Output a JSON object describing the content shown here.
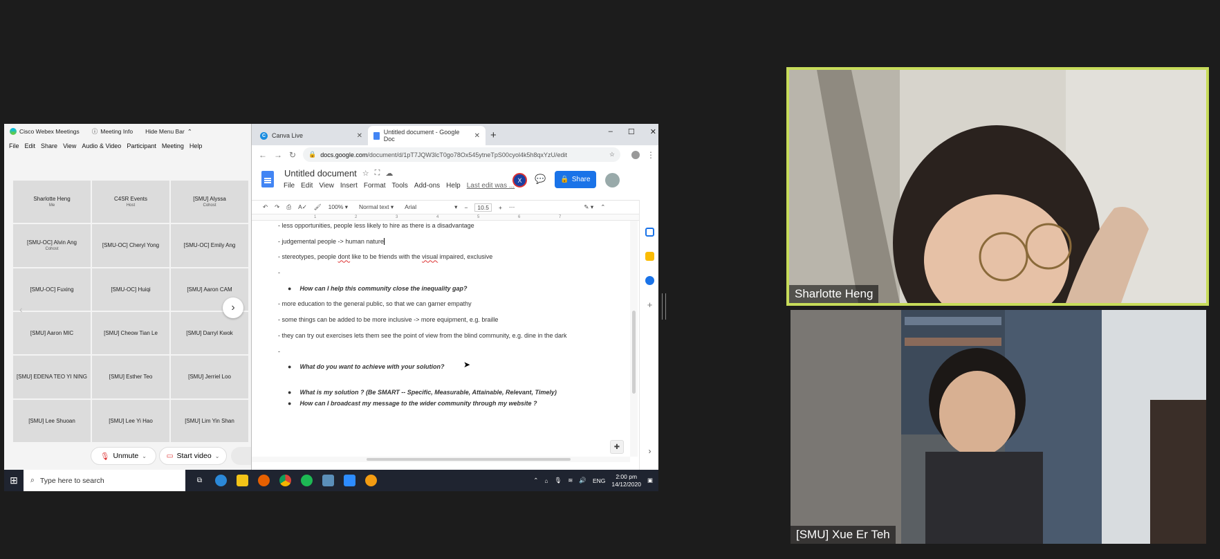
{
  "webex": {
    "app_title": "Cisco Webex Meetings",
    "meeting_info": "Meeting Info",
    "hide_menu": "Hide Menu Bar",
    "menu": [
      "File",
      "Edit",
      "Share",
      "View",
      "Audio & Video",
      "Participant",
      "Meeting",
      "Help"
    ],
    "participants": [
      {
        "name": "Sharlotte Heng",
        "role": "Me"
      },
      {
        "name": "C4SR Events",
        "role": "Host"
      },
      {
        "name": "[SMU] Alyssa",
        "role": "Cohost"
      },
      {
        "name": "[SMU-OC] Alvin Ang",
        "role": "Cohost"
      },
      {
        "name": "[SMU-OC] Cheryl Yong",
        "role": ""
      },
      {
        "name": "[SMU-OC] Emily Ang",
        "role": ""
      },
      {
        "name": "[SMU-OC] Fuxing",
        "role": ""
      },
      {
        "name": "[SMU-OC] Huiqi",
        "role": ""
      },
      {
        "name": "[SMU] Aaron CAM",
        "role": ""
      },
      {
        "name": "[SMU] Aaron MIC",
        "role": ""
      },
      {
        "name": "[SMU] Cheow Tian Le",
        "role": ""
      },
      {
        "name": "[SMU] Darryl Kwok",
        "role": ""
      },
      {
        "name": "[SMU] EDENA TEO YI NING",
        "role": ""
      },
      {
        "name": "[SMU] Esther Teo",
        "role": ""
      },
      {
        "name": "[SMU] Jerriel Loo",
        "role": ""
      },
      {
        "name": "[SMU] Lee Shuoan",
        "role": ""
      },
      {
        "name": "[SMU] Lee Yi Hao",
        "role": ""
      },
      {
        "name": "[SMU] Lim Yin Shan",
        "role": ""
      }
    ],
    "unmute_label": "Unmute",
    "start_video_label": "Start video"
  },
  "chrome": {
    "tabs": [
      {
        "label": "Canva Live",
        "favicon": "canva-icon"
      },
      {
        "label": "Untitled document - Google Doc",
        "favicon": "docs-icon"
      }
    ],
    "url_host": "docs.google.com",
    "url_path": "/document/d/1pT7JQW3lcT0go78Ox545ytneTpS00cyol4k5h8qxYzU/edit"
  },
  "docs": {
    "title": "Untitled document",
    "menu": [
      "File",
      "Edit",
      "View",
      "Insert",
      "Format",
      "Tools",
      "Add-ons",
      "Help"
    ],
    "last_edit": "Last edit was ...",
    "collaborator_initial": "X",
    "share_label": "Share",
    "toolbar": {
      "zoom": "100%",
      "style": "Normal text",
      "font": "Arial",
      "size": "10.5"
    },
    "ruler_ticks": [
      "1",
      "2",
      "3",
      "4",
      "5",
      "6",
      "7"
    ],
    "lines": {
      "l1": "- less opportunities, people less likely to hire as there is a disadvantage",
      "l2": "- judgemental people -> human nature",
      "l3_a": "- stereotypes, people ",
      "l3_err1": "dont",
      "l3_b": " like to be friends with the ",
      "l3_err2": "visual",
      "l3_c": " impaired, exclusive",
      "l4": "-",
      "q1": "How can I help this community close the inequality gap?",
      "l5": "- more education to the general public, so that we can garner empathy",
      "l6": "- some things can be added to be more inclusive -> more equipment, e.g. braille",
      "l7": "- they can try out exercises lets them see the point of view from the blind community, e.g. dine in the dark",
      "l8": "-",
      "q2": "What do you want to achieve with your solution?",
      "q3": "What is my solution ? (Be SMART -- Specific, Measurable, Attainable, Relevant, Timely)",
      "q4": "How can I broadcast my message to the wider community through my website ?"
    }
  },
  "taskbar": {
    "search_placeholder": "Type here to search",
    "lang": "ENG",
    "time": "2:00 pm",
    "date": "14/12/2020"
  },
  "videos": {
    "top_name": "Sharlotte Heng",
    "bottom_name": "[SMU] Xue Er Teh",
    "active_speaker_border": "#c7dc5a"
  }
}
